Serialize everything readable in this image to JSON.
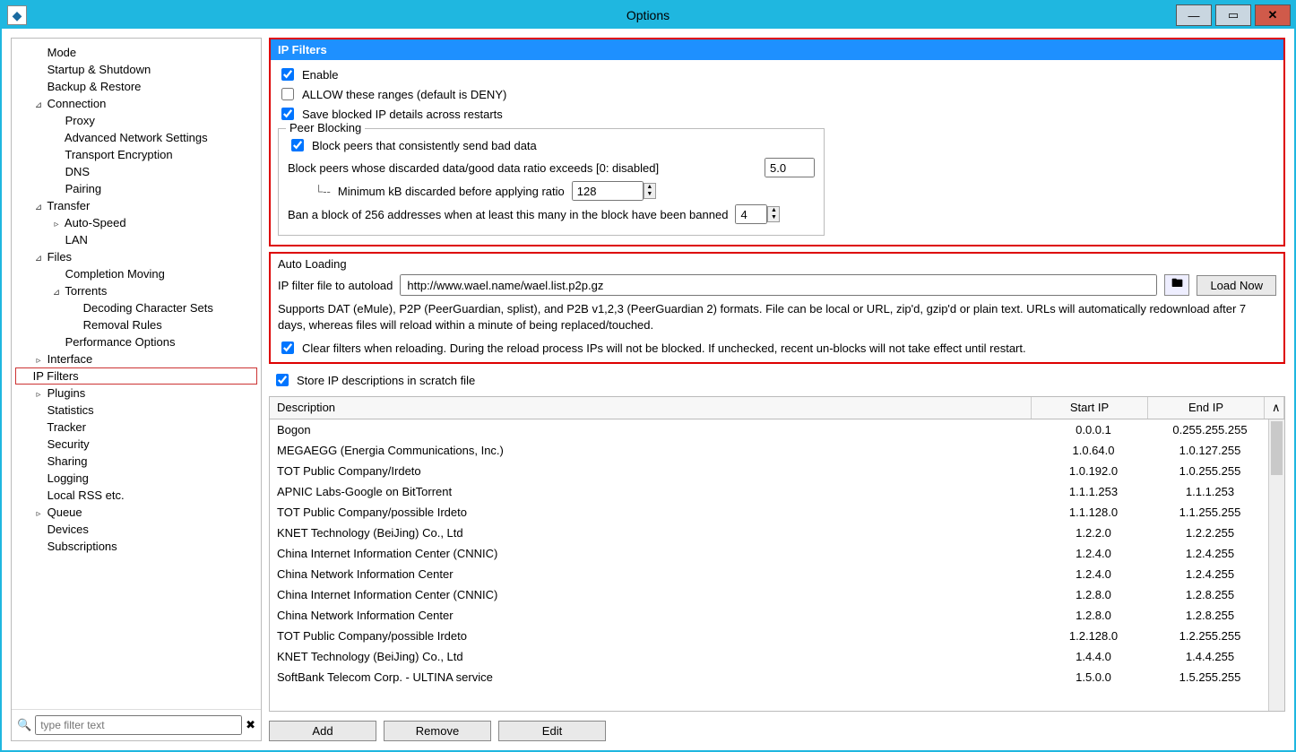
{
  "window": {
    "title": "Options"
  },
  "sidebar": {
    "filter_placeholder": "type filter text",
    "items": [
      {
        "label": "Mode",
        "indent": 0,
        "twisty": ""
      },
      {
        "label": "Startup & Shutdown",
        "indent": 0,
        "twisty": ""
      },
      {
        "label": "Backup & Restore",
        "indent": 0,
        "twisty": ""
      },
      {
        "label": "Connection",
        "indent": 0,
        "twisty": "⊿"
      },
      {
        "label": "Proxy",
        "indent": 1,
        "twisty": ""
      },
      {
        "label": "Advanced Network Settings",
        "indent": 1,
        "twisty": ""
      },
      {
        "label": "Transport Encryption",
        "indent": 1,
        "twisty": ""
      },
      {
        "label": "DNS",
        "indent": 1,
        "twisty": ""
      },
      {
        "label": "Pairing",
        "indent": 1,
        "twisty": ""
      },
      {
        "label": "Transfer",
        "indent": 0,
        "twisty": "⊿"
      },
      {
        "label": "Auto-Speed",
        "indent": 1,
        "twisty": "▹"
      },
      {
        "label": "LAN",
        "indent": 1,
        "twisty": ""
      },
      {
        "label": "Files",
        "indent": 0,
        "twisty": "⊿"
      },
      {
        "label": "Completion Moving",
        "indent": 1,
        "twisty": ""
      },
      {
        "label": "Torrents",
        "indent": 1,
        "twisty": "⊿"
      },
      {
        "label": "Decoding Character Sets",
        "indent": 2,
        "twisty": ""
      },
      {
        "label": "Removal Rules",
        "indent": 2,
        "twisty": ""
      },
      {
        "label": "Performance Options",
        "indent": 1,
        "twisty": ""
      },
      {
        "label": "Interface",
        "indent": 0,
        "twisty": "▹"
      },
      {
        "label": "IP Filters",
        "indent": 0,
        "twisty": "",
        "selected": true
      },
      {
        "label": "Plugins",
        "indent": 0,
        "twisty": "▹"
      },
      {
        "label": "Statistics",
        "indent": 0,
        "twisty": ""
      },
      {
        "label": "Tracker",
        "indent": 0,
        "twisty": ""
      },
      {
        "label": "Security",
        "indent": 0,
        "twisty": ""
      },
      {
        "label": "Sharing",
        "indent": 0,
        "twisty": ""
      },
      {
        "label": "Logging",
        "indent": 0,
        "twisty": ""
      },
      {
        "label": "Local RSS etc.",
        "indent": 0,
        "twisty": ""
      },
      {
        "label": "Queue",
        "indent": 0,
        "twisty": "▹"
      },
      {
        "label": "Devices",
        "indent": 0,
        "twisty": ""
      },
      {
        "label": "Subscriptions",
        "indent": 0,
        "twisty": ""
      }
    ]
  },
  "heading": "IP Filters",
  "checks": {
    "enable": "Enable",
    "allow": "ALLOW these ranges (default is DENY)",
    "save": "Save blocked IP details across restarts"
  },
  "peer": {
    "group": "Peer Blocking",
    "block_bad": "Block peers that consistently send bad data",
    "ratio_label": "Block peers whose discarded data/good data ratio exceeds [0: disabled]",
    "ratio_value": "5.0",
    "min_label": "Minimum kB discarded before applying ratio",
    "min_value": "128",
    "ban_label": "Ban a block of 256 addresses when at least this many in the block have been banned",
    "ban_value": "4"
  },
  "autoload": {
    "group": "Auto Loading",
    "label": "IP filter file to autoload",
    "value": "http://www.wael.name/wael.list.p2p.gz",
    "loadnow": "Load Now",
    "help": "Supports DAT (eMule), P2P (PeerGuardian, splist), and P2B v1,2,3 (PeerGuardian 2) formats.  File can be local or URL, zip'd, gzip'd or plain text.  URLs will automatically redownload after 7 days, whereas files will reload within a minute of being replaced/touched.",
    "clear": "Clear filters when reloading. During the reload process IPs will not be blocked. If unchecked, recent un-blocks will not take effect until restart."
  },
  "scratch": "Store IP descriptions in scratch file",
  "table": {
    "cols": {
      "desc": "Description",
      "start": "Start IP",
      "end": "End IP"
    },
    "rows": [
      {
        "desc": "Bogon",
        "start": "0.0.0.1",
        "end": "0.255.255.255"
      },
      {
        "desc": "MEGAEGG (Energia Communications, Inc.)",
        "start": "1.0.64.0",
        "end": "1.0.127.255"
      },
      {
        "desc": "TOT Public Company/Irdeto",
        "start": "1.0.192.0",
        "end": "1.0.255.255"
      },
      {
        "desc": "APNIC Labs-Google on BitTorrent",
        "start": "1.1.1.253",
        "end": "1.1.1.253"
      },
      {
        "desc": "TOT Public Company/possible Irdeto",
        "start": "1.1.128.0",
        "end": "1.1.255.255"
      },
      {
        "desc": "KNET Technology (BeiJing) Co., Ltd",
        "start": "1.2.2.0",
        "end": "1.2.2.255"
      },
      {
        "desc": "China Internet Information Center (CNNIC)",
        "start": "1.2.4.0",
        "end": "1.2.4.255"
      },
      {
        "desc": "China Network Information Center",
        "start": "1.2.4.0",
        "end": "1.2.4.255"
      },
      {
        "desc": "China Internet Information Center (CNNIC)",
        "start": "1.2.8.0",
        "end": "1.2.8.255"
      },
      {
        "desc": "China Network Information Center",
        "start": "1.2.8.0",
        "end": "1.2.8.255"
      },
      {
        "desc": "TOT Public Company/possible Irdeto",
        "start": "1.2.128.0",
        "end": "1.2.255.255"
      },
      {
        "desc": "KNET Technology (BeiJing) Co., Ltd",
        "start": "1.4.4.0",
        "end": "1.4.4.255"
      },
      {
        "desc": "SoftBank Telecom Corp. - ULTINA service",
        "start": "1.5.0.0",
        "end": "1.5.255.255"
      }
    ]
  },
  "buttons": {
    "add": "Add",
    "remove": "Remove",
    "edit": "Edit"
  }
}
